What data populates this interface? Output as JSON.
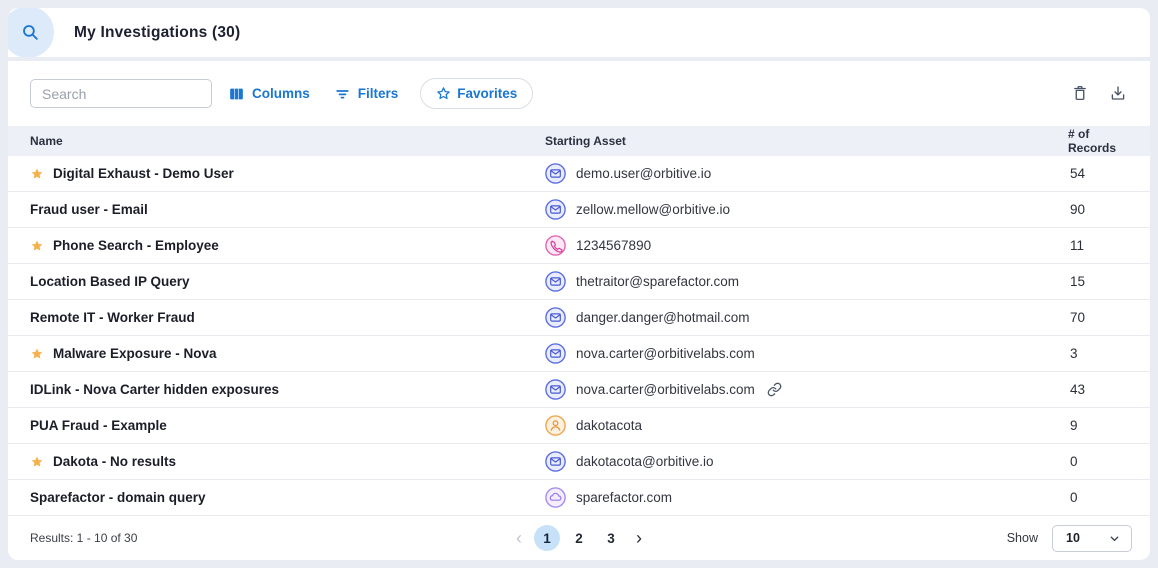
{
  "header": {
    "title": "My Investigations (30)"
  },
  "toolbar": {
    "search_placeholder": "Search",
    "columns_label": "Columns",
    "filters_label": "Filters",
    "favorites_label": "Favorites",
    "icons": [
      "columns-icon",
      "filter-icon",
      "star-outline-icon",
      "trash-icon",
      "download-icon"
    ]
  },
  "table": {
    "columns": [
      "Name",
      "Starting Asset",
      "# of Records"
    ],
    "asset_icon_names": {
      "email": "email-icon",
      "phone": "phone-icon",
      "username": "user-icon",
      "domain": "domain-icon"
    },
    "rows": [
      {
        "starred": true,
        "name": "Digital Exhaust - Demo User",
        "asset_type": "email",
        "asset": "demo.user@orbitive.io",
        "linked": false,
        "records": "54"
      },
      {
        "starred": false,
        "name": "Fraud user - Email",
        "asset_type": "email",
        "asset": "zellow.mellow@orbitive.io",
        "linked": false,
        "records": "90"
      },
      {
        "starred": true,
        "name": "Phone Search - Employee",
        "asset_type": "phone",
        "asset": "1234567890",
        "linked": false,
        "records": "11"
      },
      {
        "starred": false,
        "name": "Location Based IP Query",
        "asset_type": "email",
        "asset": "thetraitor@sparefactor.com",
        "linked": false,
        "records": "15"
      },
      {
        "starred": false,
        "name": "Remote IT - Worker Fraud",
        "asset_type": "email",
        "asset": "danger.danger@hotmail.com",
        "linked": false,
        "records": "70"
      },
      {
        "starred": true,
        "name": "Malware Exposure - Nova",
        "asset_type": "email",
        "asset": "nova.carter@orbitivelabs.com",
        "linked": false,
        "records": "3"
      },
      {
        "starred": false,
        "name": "IDLink - Nova Carter hidden exposures",
        "asset_type": "email",
        "asset": "nova.carter@orbitivelabs.com",
        "linked": true,
        "records": "43"
      },
      {
        "starred": false,
        "name": "PUA Fraud - Example",
        "asset_type": "username",
        "asset": "dakotacota",
        "linked": false,
        "records": "9"
      },
      {
        "starred": true,
        "name": "Dakota - No results",
        "asset_type": "email",
        "asset": "dakotacota@orbitive.io",
        "linked": false,
        "records": "0"
      },
      {
        "starred": false,
        "name": "Sparefactor - domain query",
        "asset_type": "domain",
        "asset": "sparefactor.com",
        "linked": false,
        "records": "0"
      }
    ]
  },
  "footer": {
    "results_text": "Results: 1 - 10 of 30",
    "pages": [
      "1",
      "2",
      "3"
    ],
    "active_page": "1",
    "prev_icon": "chevron-left-icon",
    "next_icon": "chevron-right-icon",
    "show_label": "Show",
    "page_size": "10"
  },
  "colors": {
    "accent_blue": "#1976d2",
    "title_text": "#1c2030",
    "star_orange": "#f6b14e",
    "active_page_bg": "#c7e2f8",
    "table_header_bg": "#edf1f7",
    "page_bg": "#e9edf3",
    "email_icon": "#5b6ee0",
    "phone_icon": "#e066b2",
    "user_icon": "#eda64f",
    "domain_icon": "#a78bf0"
  }
}
